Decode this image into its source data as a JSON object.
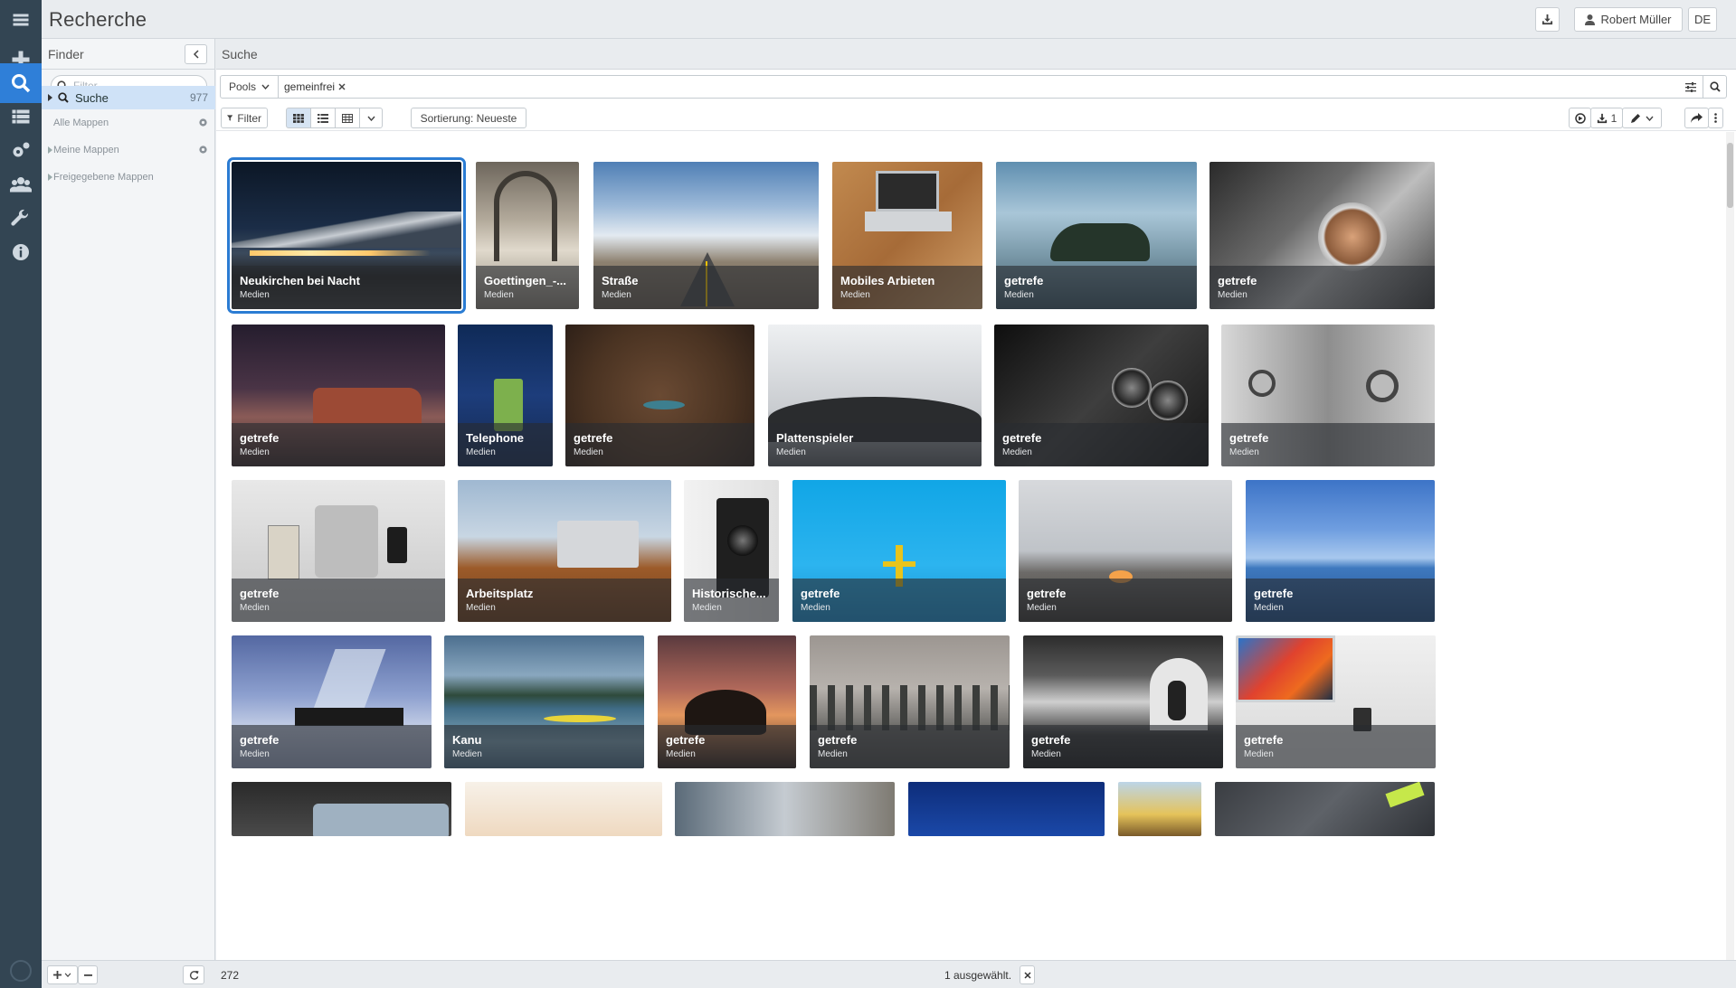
{
  "app": {
    "title": "Recherche",
    "user": "Robert Müller",
    "language": "DE"
  },
  "finder": {
    "title": "Finder",
    "filter_placeholder": "Filter",
    "items": [
      {
        "label": "Suche",
        "count": "977"
      },
      {
        "label": "Alle Mappen"
      },
      {
        "label": "Meine Mappen"
      },
      {
        "label": "Freigegebene Mappen"
      }
    ]
  },
  "main": {
    "title": "Suche",
    "pools_label": "Pools",
    "search_tag": "gemeinfrei",
    "filter_label": "Filter",
    "sort_label": "Sortierung: Neueste",
    "download_count": "1"
  },
  "tiles": [
    {
      "title": "Neukirchen bei Nacht",
      "sub": "Medien"
    },
    {
      "title": "Goettingen_-...",
      "sub": "Medien"
    },
    {
      "title": "Straße",
      "sub": "Medien"
    },
    {
      "title": "Mobiles Arbieten",
      "sub": "Medien"
    },
    {
      "title": "getrefe",
      "sub": "Medien"
    },
    {
      "title": "getrefe",
      "sub": "Medien"
    },
    {
      "title": "getrefe",
      "sub": "Medien"
    },
    {
      "title": "Telephone",
      "sub": "Medien"
    },
    {
      "title": "getrefe",
      "sub": "Medien"
    },
    {
      "title": "Plattenspieler",
      "sub": "Medien"
    },
    {
      "title": "getrefe",
      "sub": "Medien"
    },
    {
      "title": "getrefe",
      "sub": "Medien"
    },
    {
      "title": "getrefe",
      "sub": "Medien"
    },
    {
      "title": "Arbeitsplatz",
      "sub": "Medien"
    },
    {
      "title": "Historische...",
      "sub": "Medien"
    },
    {
      "title": "getrefe",
      "sub": "Medien"
    },
    {
      "title": "getrefe",
      "sub": "Medien"
    },
    {
      "title": "getrefe",
      "sub": "Medien"
    },
    {
      "title": "getrefe",
      "sub": "Medien"
    },
    {
      "title": "Kanu",
      "sub": "Medien"
    },
    {
      "title": "getrefe",
      "sub": "Medien"
    },
    {
      "title": "getrefe",
      "sub": "Medien"
    },
    {
      "title": "getrefe",
      "sub": "Medien"
    },
    {
      "title": "getrefe",
      "sub": "Medien"
    }
  ],
  "status": {
    "count": "272",
    "selected": "1 ausgewählt."
  },
  "colors": {
    "accent": "#2b7cd3",
    "rail": "#334553",
    "rail_active": "#2f7fd8"
  }
}
